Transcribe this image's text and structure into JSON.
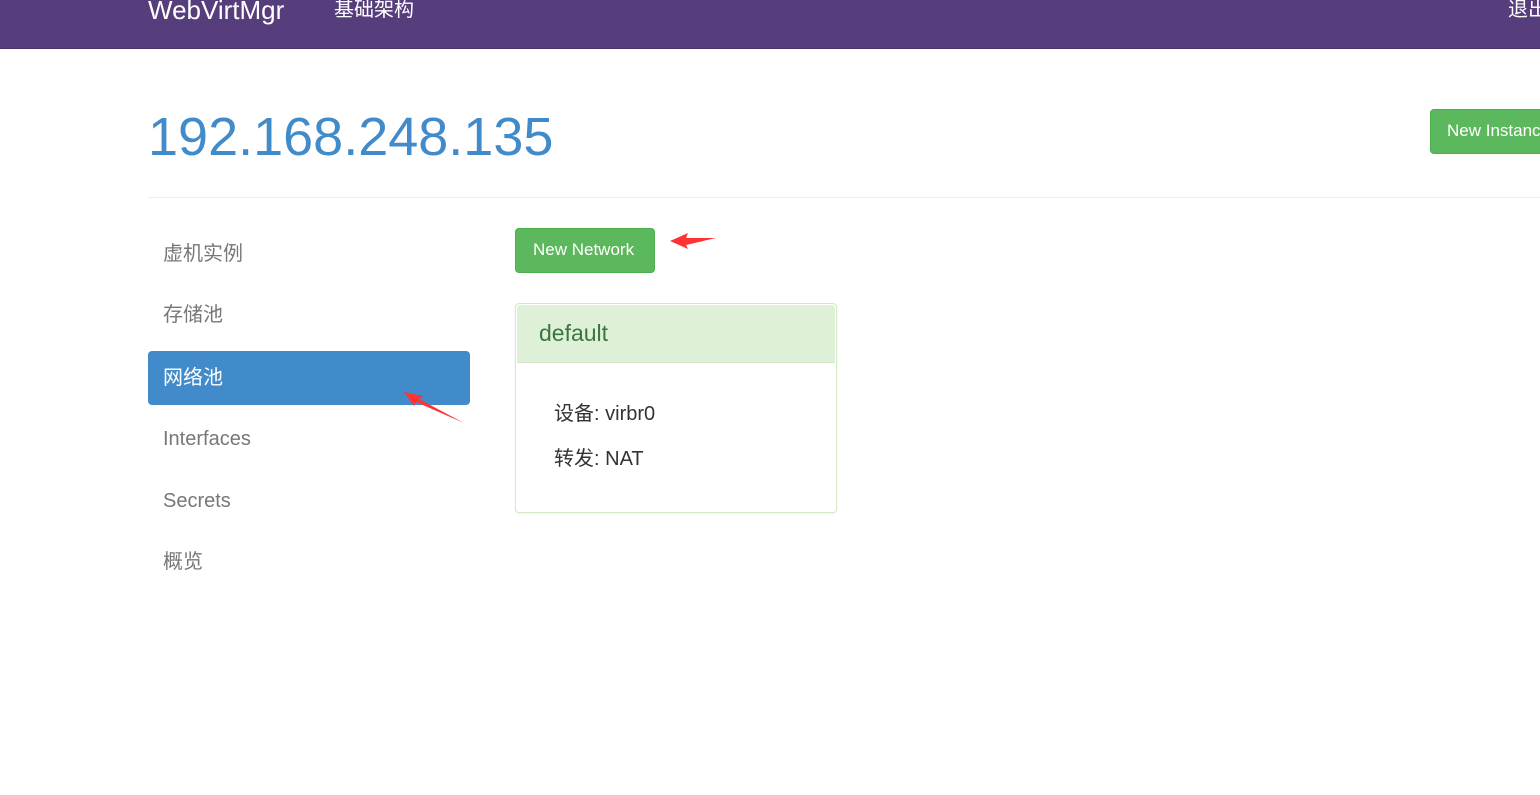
{
  "navbar": {
    "brand": "WebVirtMgr",
    "infrastructure_link": "基础架构",
    "logout_link": "退出"
  },
  "header": {
    "host_title": "192.168.248.135",
    "new_instance_button": "New Instance"
  },
  "sidebar": {
    "items": [
      {
        "label": "虚机实例",
        "active": false
      },
      {
        "label": "存储池",
        "active": false
      },
      {
        "label": "网络池",
        "active": true
      },
      {
        "label": "Interfaces",
        "active": false
      },
      {
        "label": "Secrets",
        "active": false
      },
      {
        "label": "概览",
        "active": false
      }
    ]
  },
  "main": {
    "new_network_button": "New Network",
    "networks": [
      {
        "name": "default",
        "device_label": "设备:",
        "device_value": "virbr0",
        "forward_label": "转发:",
        "forward_value": "NAT"
      }
    ]
  },
  "colors": {
    "navbar": "#563d7c",
    "accent": "#428bca",
    "success": "#5cb85c",
    "panel_heading": "#dff0d8",
    "annotation_arrow": "#ff3333"
  }
}
